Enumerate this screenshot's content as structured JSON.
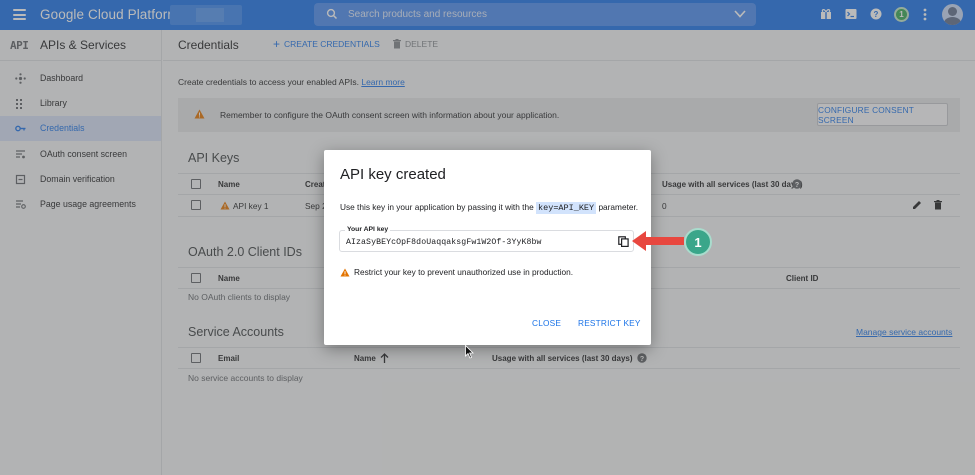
{
  "topbar": {
    "brand": "Google Cloud Platform",
    "search_placeholder": "Search products and resources",
    "badge": "1"
  },
  "sidebar": {
    "logo": "API",
    "title": "APIs & Services",
    "items": [
      {
        "label": "Dashboard",
        "icon": "dashboard-icon"
      },
      {
        "label": "Library",
        "icon": "library-icon"
      },
      {
        "label": "Credentials",
        "icon": "key-icon",
        "active": true
      },
      {
        "label": "OAuth consent screen",
        "icon": "consent-icon"
      },
      {
        "label": "Domain verification",
        "icon": "checkbox-icon"
      },
      {
        "label": "Page usage agreements",
        "icon": "settings-list-icon"
      }
    ]
  },
  "main": {
    "title": "Credentials",
    "create_label": "CREATE CREDENTIALS",
    "delete_label": "DELETE",
    "intro_text": "Create credentials to access your enabled APIs.",
    "learn_more": "Learn more",
    "notice_text": "Remember to configure the OAuth consent screen with information about your application.",
    "configure_btn": "CONFIGURE CONSENT SCREEN",
    "api_keys": {
      "title": "API Keys",
      "col_name": "Name",
      "col_created": "Creat",
      "col_usage": "Usage with all services (last 30 days)",
      "row": {
        "name": "API key 1",
        "created": "Sep 2",
        "usage": "0"
      }
    },
    "oauth": {
      "title": "OAuth 2.0 Client IDs",
      "col_name": "Name",
      "col_client": "Client ID",
      "empty": "No OAuth clients to display"
    },
    "service": {
      "title": "Service Accounts",
      "manage_link": "Manage service accounts",
      "col_email": "Email",
      "col_name": "Name",
      "col_usage": "Usage with all services (last 30 days)",
      "empty": "No service accounts to display"
    }
  },
  "dialog": {
    "title": "API key created",
    "desc_before": "Use this key in your application by passing it with the",
    "desc_code": "key=API_KEY",
    "desc_after": "parameter.",
    "key_label": "Your API key",
    "key_value": "AIzaSyBEYcOpF8doUaqqaksgFw1W2Of-3YyK8bw",
    "restrict_note": "Restrict your key to prevent unauthorized use in production.",
    "close_btn": "CLOSE",
    "restrict_btn": "RESTRICT KEY"
  },
  "annotation": {
    "step": "1",
    "arrow_color": "#e8473f",
    "badge_color": "#3aa68a"
  },
  "colors": {
    "primary": "#1a73e8",
    "warning": "#e37400"
  }
}
